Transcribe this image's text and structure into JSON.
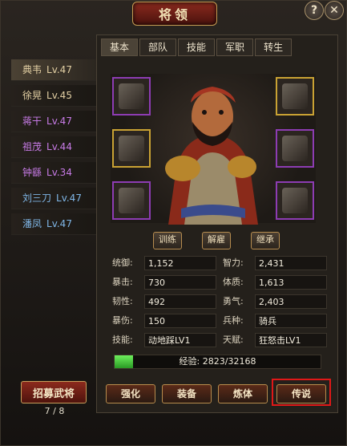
{
  "window": {
    "title": "将领"
  },
  "header_buttons": {
    "help": "?",
    "close": "✕"
  },
  "generals": [
    {
      "name": "典韦",
      "level": "Lv.47",
      "color": "#e2cfa3",
      "selected": true
    },
    {
      "name": "徐晃",
      "level": "Lv.45",
      "color": "#e2cfa3",
      "selected": false
    },
    {
      "name": "蒋干",
      "level": "Lv.47",
      "color": "#c77be6",
      "selected": false
    },
    {
      "name": "祖茂",
      "level": "Lv.44",
      "color": "#c77be6",
      "selected": false
    },
    {
      "name": "钟繇",
      "level": "Lv.34",
      "color": "#c77be6",
      "selected": false
    },
    {
      "name": "刘三刀",
      "level": "Lv.47",
      "color": "#7fb6e6",
      "selected": false
    },
    {
      "name": "潘凤",
      "level": "Lv.47",
      "color": "#7fb6e6",
      "selected": false
    }
  ],
  "recruit": {
    "label": "招募武将",
    "count": "7 / 8"
  },
  "tabs": [
    "基本",
    "部队",
    "技能",
    "军职",
    "转生"
  ],
  "action_buttons": {
    "train": "训练",
    "dismiss": "解雇",
    "inherit": "继承"
  },
  "stats": {
    "left": [
      {
        "label": "统御:",
        "value": "1,152"
      },
      {
        "label": "暴击:",
        "value": "730"
      },
      {
        "label": "韧性:",
        "value": "492"
      },
      {
        "label": "暴伤:",
        "value": "150"
      },
      {
        "label": "技能:",
        "value": "动地踩LV1"
      }
    ],
    "right": [
      {
        "label": "智力:",
        "value": "2,431"
      },
      {
        "label": "体质:",
        "value": "1,613"
      },
      {
        "label": "勇气:",
        "value": "2,403"
      },
      {
        "label": "兵种:",
        "value": "骑兵"
      },
      {
        "label": "天赋:",
        "value": "狂怒击LV1"
      }
    ]
  },
  "experience": {
    "label": "经验:",
    "current": "2823",
    "max": "32168",
    "display": "经验:  2823/32168",
    "fill_fraction": 0.0878
  },
  "bottom_buttons": {
    "strengthen": "强化",
    "equip": "装备",
    "refine": "炼体",
    "legend": "传说"
  },
  "equipment_slots": {
    "top_left": {
      "rarity": "purple"
    },
    "top_right": {
      "rarity": "gold"
    },
    "mid_left": {
      "rarity": "gold"
    },
    "mid_right": {
      "rarity": "purple"
    },
    "bottom_left": {
      "rarity": "purple"
    },
    "bottom_right": {
      "rarity": "purple"
    }
  },
  "colors": {
    "accent_red": "#8c2a1d",
    "border_gold": "#c79e5a",
    "xp_green": "#3fcf34",
    "highlight": "#e01818"
  }
}
